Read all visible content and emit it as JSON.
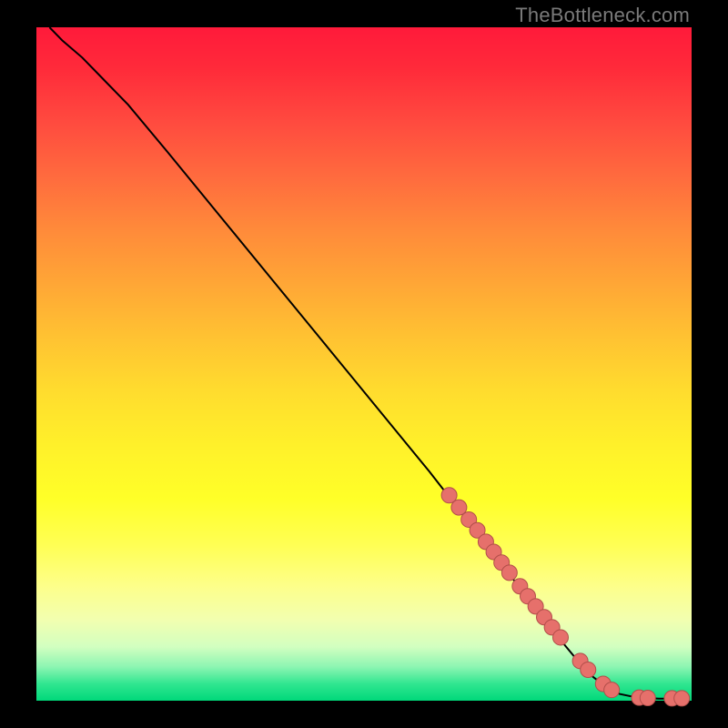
{
  "attribution": "TheBottleneck.com",
  "colors": {
    "marker_fill": "#e6706b",
    "marker_stroke": "#b24e4a",
    "line_stroke": "#000000",
    "frame_bg": "#000000"
  },
  "chart_data": {
    "type": "line",
    "title": "",
    "xlabel": "",
    "ylabel": "",
    "xlim": [
      0,
      100
    ],
    "ylim": [
      0,
      100
    ],
    "grid": false,
    "legend": false,
    "note": "No axis tick labels are shown; x/y values are read as percentage of plot width/height from bottom-left.",
    "series": [
      {
        "name": "curve",
        "kind": "line",
        "x": [
          2,
          4,
          7,
          10,
          14,
          20,
          28,
          36,
          44,
          52,
          60,
          66,
          72,
          76,
          80,
          83,
          85,
          87,
          89,
          91,
          93,
          95,
          97,
          99
        ],
        "y": [
          100,
          98,
          95.5,
          92.5,
          88.5,
          81.5,
          72,
          62.5,
          53,
          43.5,
          34,
          26.5,
          19,
          14,
          9,
          5.5,
          3.5,
          2,
          1,
          0.6,
          0.4,
          0.3,
          0.3,
          0.3
        ]
      },
      {
        "name": "markers",
        "kind": "scatter",
        "x": [
          63,
          64.5,
          66,
          67.3,
          68.6,
          69.8,
          71,
          72.2,
          73.8,
          75,
          76.2,
          77.5,
          78.7,
          80,
          83,
          84.2,
          86.5,
          87.8,
          92,
          93.3,
          97,
          98.5
        ],
        "y": [
          30.5,
          28.7,
          26.9,
          25.3,
          23.6,
          22.1,
          20.5,
          19,
          17,
          15.5,
          14,
          12.4,
          10.9,
          9.4,
          5.9,
          4.6,
          2.5,
          1.6,
          0.45,
          0.4,
          0.35,
          0.35
        ]
      }
    ]
  }
}
